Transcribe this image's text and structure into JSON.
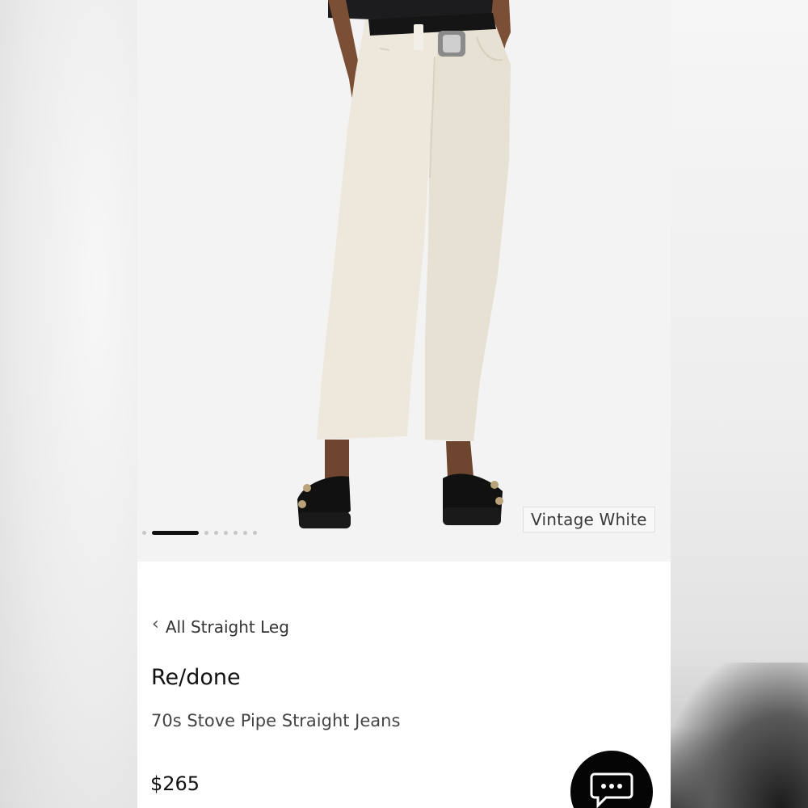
{
  "product_gallery": {
    "color_label": "Vintage White",
    "image_count": 8,
    "active_image_index": 1
  },
  "breadcrumb": {
    "back_icon": "chevron-left-icon",
    "label": "All Straight Leg"
  },
  "product": {
    "brand": "Re/done",
    "name": "70s Stove Pipe Straight Jeans",
    "price": "$265"
  },
  "chat": {
    "icon": "chat-bubble-icon"
  },
  "colors": {
    "accent": "#000000",
    "text": "#111111",
    "muted": "#444444",
    "hero_bg": "#f3f3f3"
  }
}
